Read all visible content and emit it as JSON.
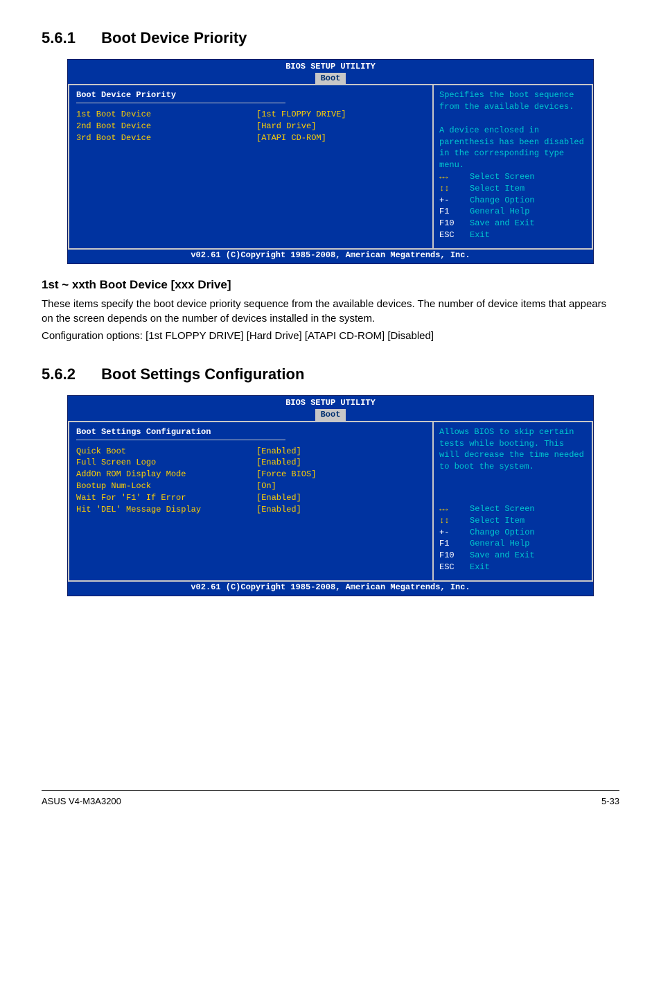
{
  "sections": {
    "s561": {
      "num": "5.6.1",
      "title": "Boot Device Priority"
    },
    "s562": {
      "num": "5.6.2",
      "title": "Boot Settings Configuration"
    }
  },
  "bios_common": {
    "header": "BIOS SETUP UTILITY",
    "tab": "Boot",
    "footer": "v02.61 (C)Copyright 1985-2008, American Megatrends, Inc.",
    "nav": {
      "select_screen": "Select Screen",
      "select_item": "Select Item",
      "change_option_key": "+-",
      "change_option": "Change Option",
      "general_help_key": "F1",
      "general_help": "General Help",
      "save_exit_key": "F10",
      "save_exit": "Save and Exit",
      "exit_key": "ESC",
      "exit": "Exit"
    }
  },
  "bios1": {
    "left_title": "Boot Device Priority",
    "rows": [
      {
        "label": "1st Boot Device",
        "value": "[1st FLOPPY DRIVE]"
      },
      {
        "label": "2nd Boot Device",
        "value": "[Hard Drive]"
      },
      {
        "label": "3rd Boot Device",
        "value": "[ATAPI CD-ROM]"
      }
    ],
    "help": "Specifies the boot sequence from the available devices.\n\nA device enclosed in parenthesis has been disabled in the corresponding type menu."
  },
  "body1": {
    "subheading": "1st ~ xxth Boot Device [xxx Drive]",
    "p1": "These items specify the boot device priority sequence from the available devices. The number of device items that appears on the screen depends on the number of devices installed in the system.",
    "p2": "Configuration options: [1st FLOPPY DRIVE] [Hard Drive] [ATAPI CD-ROM] [Disabled]"
  },
  "bios2": {
    "left_title": "Boot Settings Configuration",
    "rows": [
      {
        "label": "Quick Boot",
        "value": "[Enabled]"
      },
      {
        "label": "Full Screen Logo",
        "value": "[Enabled]"
      },
      {
        "label": "AddOn ROM Display Mode",
        "value": "[Force BIOS]"
      },
      {
        "label": "Bootup Num-Lock",
        "value": "[On]"
      },
      {
        "label": "Wait For 'F1' If Error",
        "value": "[Enabled]"
      },
      {
        "label": "Hit 'DEL' Message Display",
        "value": "[Enabled]"
      }
    ],
    "help": "Allows BIOS to skip certain tests while booting. This will decrease the time needed to boot the system."
  },
  "footer": {
    "left": "ASUS V4-M3A3200",
    "right": "5-33"
  }
}
